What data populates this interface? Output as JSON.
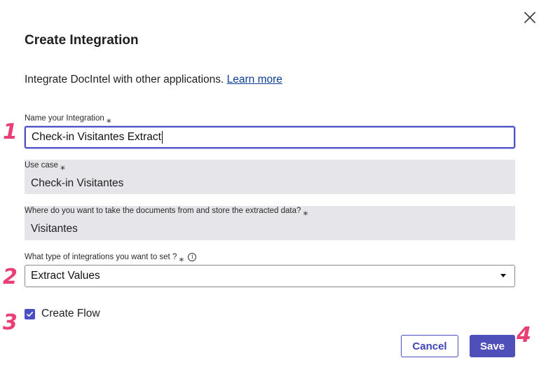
{
  "dialog": {
    "title": "Create Integration",
    "intro_text": "Integrate DocIntel with other applications. ",
    "learn_more": "Learn more"
  },
  "fields": {
    "name": {
      "label": "Name your Integration",
      "required_mark": "⁎",
      "value": "Check-in Visitantes Extract"
    },
    "use_case": {
      "label": "Use case",
      "required_mark": "⁎",
      "value": "Check-in Visitantes"
    },
    "storage": {
      "label": "Where do you want to take the documents from and store the extracted data?",
      "required_mark": "⁎",
      "value": "Visitantes"
    },
    "integration_type": {
      "label": "What type of integrations you want to set ?",
      "required_mark": "⁎",
      "info_icon": "i",
      "selected": "Extract Values"
    }
  },
  "create_flow": {
    "label": "Create Flow",
    "checked": true
  },
  "buttons": {
    "cancel": "Cancel",
    "save": "Save"
  },
  "annotations": [
    "1",
    "2",
    "3",
    "4"
  ],
  "colors": {
    "accent": "#4a4fc4",
    "annotation": "#ea3f74",
    "readonly_bg": "#e6e6ea"
  }
}
